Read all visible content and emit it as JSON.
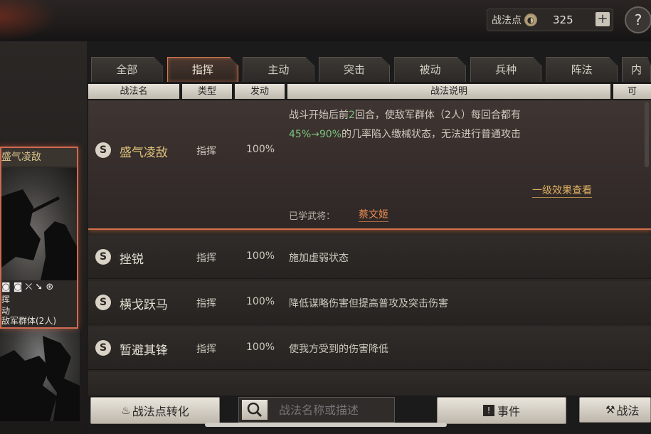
{
  "topbar": {
    "points_label": "战法点",
    "points_icon": "coin-icon",
    "points_value": "325",
    "plus": "+",
    "help": "?"
  },
  "card": {
    "title": "盛气凌敌",
    "icons": "◙ ◙ ⛌ ➘ ⊛",
    "line1": "挥",
    "line2": "动",
    "line3": "敌军群体(2人)"
  },
  "tabs": [
    {
      "label": "全部"
    },
    {
      "label": "指挥"
    },
    {
      "label": "主动"
    },
    {
      "label": "突击"
    },
    {
      "label": "被动"
    },
    {
      "label": "兵种"
    },
    {
      "label": "阵法"
    },
    {
      "label": "内"
    }
  ],
  "columns": {
    "name": "战法名",
    "type": "类型",
    "rate": "发动",
    "desc": "战法说明",
    "more": "可"
  },
  "skills": [
    {
      "badge": "S",
      "name": "盛气凌敌",
      "type": "指挥",
      "rate": "100%",
      "desc_line1_a": "战斗开始后前",
      "desc_line1_num": "2",
      "desc_line1_b": "回合，使敌军群体（2人）每回合都有",
      "desc_line2_pct": "45%→90%",
      "desc_line2_b": "的几率陷入缴械状态，无法进行普通攻击",
      "detail_link": "一级效果查看",
      "learned_label": "已学武将：",
      "learned_name": "蔡文姬"
    },
    {
      "badge": "S",
      "name": "挫锐",
      "type": "指挥",
      "rate": "100%",
      "desc": "施加虚弱状态"
    },
    {
      "badge": "S",
      "name": "横戈跃马",
      "type": "指挥",
      "rate": "100%",
      "desc": "降低谋略伤害但提高普攻及突击伤害"
    },
    {
      "badge": "S",
      "name": "暂避其锋",
      "type": "指挥",
      "rate": "100%",
      "desc": "使我方受到的伤害降低"
    }
  ],
  "bottom": {
    "convert_label": "战法点转化",
    "search_placeholder": "战法名称或描述",
    "events_label": "事件",
    "battle_label": "战法"
  }
}
